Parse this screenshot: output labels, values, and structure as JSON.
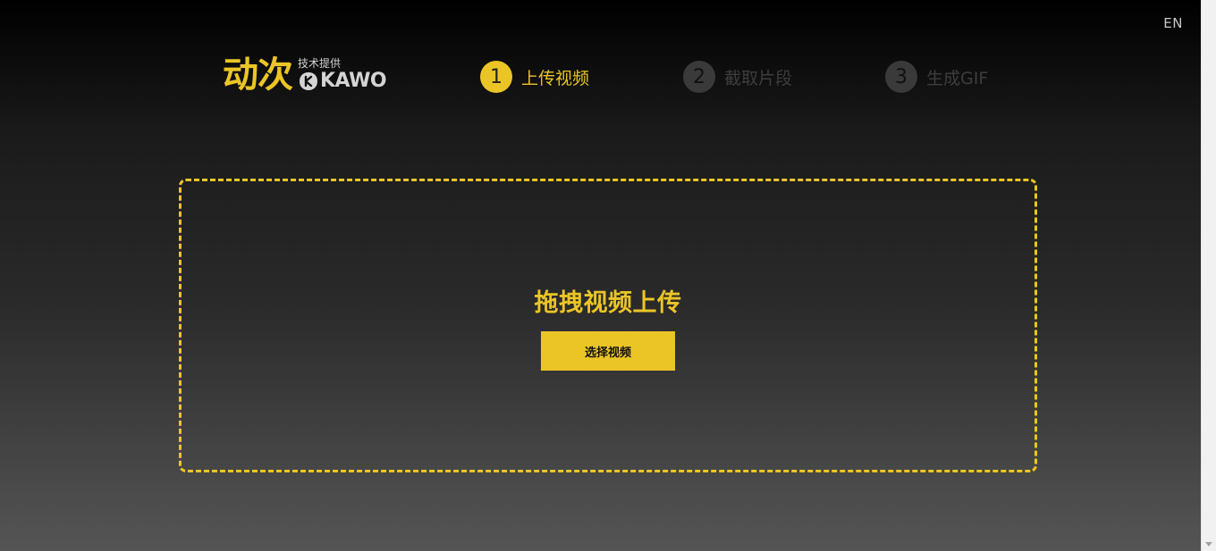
{
  "header": {
    "language_toggle": "EN",
    "logo": {
      "main": "动次",
      "tagline": "技术提供",
      "brand": "KAWO",
      "brand_color": "#d4d4d4"
    }
  },
  "steps": [
    {
      "number": "1",
      "label": "上传视频",
      "state": "active"
    },
    {
      "number": "2",
      "label": "截取片段",
      "state": "inactive"
    },
    {
      "number": "3",
      "label": "生成GIF",
      "state": "inactive"
    }
  ],
  "upload": {
    "title": "拖拽视频上传",
    "button_label": "选择视频"
  },
  "colors": {
    "accent": "#ebc526",
    "background_top": "#000000",
    "background_bottom": "#555555",
    "inactive_step": "#3a3a3a"
  },
  "icons": {
    "brand_logo": "kawo-logo-icon",
    "scroll_down": "chevron-down-icon"
  }
}
